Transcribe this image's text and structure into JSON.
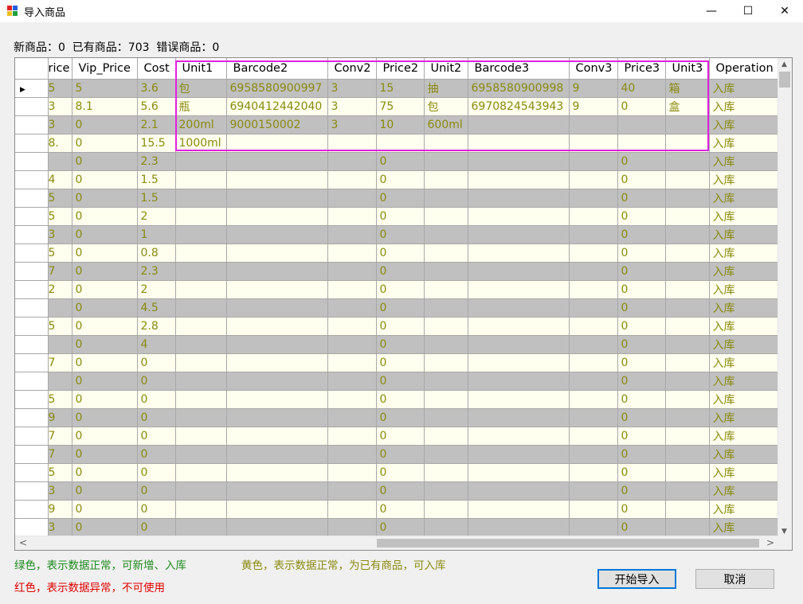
{
  "window": {
    "title": "导入商品",
    "controls": {
      "minimize": "—",
      "maximize": "☐",
      "close": "✕"
    }
  },
  "summary": "新商品：0  已有商品：703  错误商品：0",
  "table": {
    "columns": [
      "rice",
      "Vip_Price",
      "Cost",
      "Unit1",
      "Barcode2",
      "Conv2",
      "Price2",
      "Unit2",
      "Barcode3",
      "Conv3",
      "Price3",
      "Unit3",
      "Operation"
    ],
    "rows": [
      [
        "5",
        "5",
        "3.6",
        "包",
        "6958580900997",
        "3",
        "15",
        "抽",
        "6958580900998",
        "9",
        "40",
        "箱",
        "入库"
      ],
      [
        "3",
        "8.1",
        "5.6",
        "瓶",
        "6940412442040",
        "3",
        "75",
        "包",
        "6970824543943",
        "9",
        "0",
        "盒",
        "入库"
      ],
      [
        "3",
        "0",
        "2.1",
        "200ml",
        "9000150002",
        "3",
        "10",
        "600ml",
        "",
        "",
        "",
        "",
        "入库"
      ],
      [
        ".8",
        "0",
        "15.5",
        "1000ml",
        "",
        "",
        "",
        "",
        "",
        "",
        "",
        "",
        "入库"
      ],
      [
        "",
        "0",
        "2.3",
        "",
        "",
        "",
        "0",
        "",
        "",
        "",
        "0",
        "",
        "入库"
      ],
      [
        "4",
        "0",
        "1.5",
        "",
        "",
        "",
        "0",
        "",
        "",
        "",
        "0",
        "",
        "入库"
      ],
      [
        "5",
        "0",
        "1.5",
        "",
        "",
        "",
        "0",
        "",
        "",
        "",
        "0",
        "",
        "入库"
      ],
      [
        "5",
        "0",
        "2",
        "",
        "",
        "",
        "0",
        "",
        "",
        "",
        "0",
        "",
        "入库"
      ],
      [
        "3",
        "0",
        "1",
        "",
        "",
        "",
        "0",
        "",
        "",
        "",
        "0",
        "",
        "入库"
      ],
      [
        "5",
        "0",
        "0.8",
        "",
        "",
        "",
        "0",
        "",
        "",
        "",
        "0",
        "",
        "入库"
      ],
      [
        "7",
        "0",
        "2.3",
        "",
        "",
        "",
        "0",
        "",
        "",
        "",
        "0",
        "",
        "入库"
      ],
      [
        "2",
        "0",
        "2",
        "",
        "",
        "",
        "0",
        "",
        "",
        "",
        "0",
        "",
        "入库"
      ],
      [
        "",
        "0",
        "4.5",
        "",
        "",
        "",
        "0",
        "",
        "",
        "",
        "0",
        "",
        "入库"
      ],
      [
        "5",
        "0",
        "2.8",
        "",
        "",
        "",
        "0",
        "",
        "",
        "",
        "0",
        "",
        "入库"
      ],
      [
        "",
        "0",
        "4",
        "",
        "",
        "",
        "0",
        "",
        "",
        "",
        "0",
        "",
        "入库"
      ],
      [
        "7",
        "0",
        "0",
        "",
        "",
        "",
        "0",
        "",
        "",
        "",
        "0",
        "",
        "入库"
      ],
      [
        "",
        "0",
        "0",
        "",
        "",
        "",
        "0",
        "",
        "",
        "",
        "0",
        "",
        "入库"
      ],
      [
        "5",
        "0",
        "0",
        "",
        "",
        "",
        "0",
        "",
        "",
        "",
        "0",
        "",
        "入库"
      ],
      [
        "9",
        "0",
        "0",
        "",
        "",
        "",
        "0",
        "",
        "",
        "",
        "0",
        "",
        "入库"
      ],
      [
        "7",
        "0",
        "0",
        "",
        "",
        "",
        "0",
        "",
        "",
        "",
        "0",
        "",
        "入库"
      ],
      [
        "7",
        "0",
        "0",
        "",
        "",
        "",
        "0",
        "",
        "",
        "",
        "0",
        "",
        "入库"
      ],
      [
        "5",
        "0",
        "0",
        "",
        "",
        "",
        "0",
        "",
        "",
        "",
        "0",
        "",
        "入库"
      ],
      [
        "3",
        "0",
        "0",
        "",
        "",
        "",
        "0",
        "",
        "",
        "",
        "0",
        "",
        "入库"
      ],
      [
        "9",
        "0",
        "0",
        "",
        "",
        "",
        "0",
        "",
        "",
        "",
        "0",
        "",
        "入库"
      ],
      [
        "3",
        "0",
        "0",
        "",
        "",
        "",
        "0",
        "",
        "",
        "",
        "0",
        "",
        "入库"
      ]
    ],
    "current_row_marker": "▶",
    "scroll_arrows": {
      "up": "▲",
      "down": "▼",
      "left": "<",
      "right": ">"
    }
  },
  "legend": {
    "green": "绿色，表示数据正常，可新增、入库",
    "yellow": "黄色，表示数据正常，为已有商品，可入库",
    "red": "红色，表示数据异常，不可使用"
  },
  "colors": {
    "green": "#1e8a1e",
    "yellow": "#8a8a10",
    "red": "#e00000",
    "highlight": "#e020e0"
  },
  "buttons": {
    "start": "开始导入",
    "cancel": "取消"
  }
}
